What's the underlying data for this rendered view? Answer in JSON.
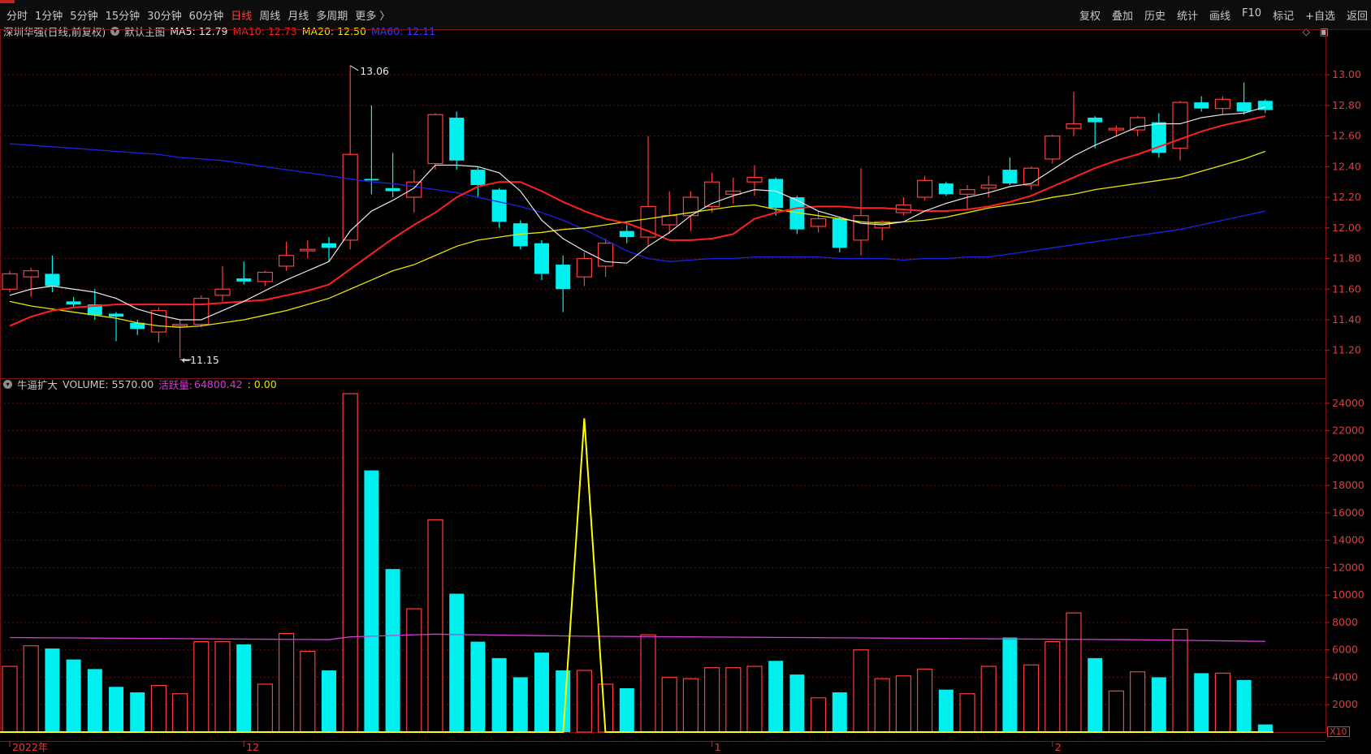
{
  "topbar": {
    "tabs": [
      {
        "label": "分时",
        "active": false
      },
      {
        "label": "1分钟",
        "active": false
      },
      {
        "label": "5分钟",
        "active": false
      },
      {
        "label": "15分钟",
        "active": false
      },
      {
        "label": "30分钟",
        "active": false
      },
      {
        "label": "60分钟",
        "active": false
      },
      {
        "label": "日线",
        "active": true
      },
      {
        "label": "周线",
        "active": false
      },
      {
        "label": "月线",
        "active": false
      },
      {
        "label": "多周期",
        "active": false
      },
      {
        "label": "更多 〉",
        "active": false
      }
    ],
    "tools": [
      "复权",
      "叠加",
      "历史",
      "统计",
      "画线",
      "F10",
      "标记",
      "+自选",
      "返回"
    ]
  },
  "info": {
    "stock": "深圳华强(日线,前复权)",
    "main_chart": "默认主图",
    "ma5": "MA5: 12.79",
    "ma10": "MA10: 12.73",
    "ma20": "MA20: 12.50",
    "ma60": "MA60: 12.11"
  },
  "vinfo": {
    "indicator": "牛逼扩大",
    "volume": "VOLUME: 5570.00",
    "active_label": "活跃量:",
    "active_value": "64800.42",
    "extra": ": 0.00"
  },
  "colors": {
    "up": "#ff3c3c",
    "down": "#00f0f0",
    "ma5": "#e8e8e8",
    "ma10": "#ff2020",
    "ma20": "#e6e600",
    "ma60": "#2020e6",
    "activity": "#d23cd2",
    "signal": "#ffff00"
  },
  "chart_data": {
    "type": "candlestick",
    "price_axis": {
      "ticks": [
        11.2,
        11.4,
        11.6,
        11.8,
        12.0,
        12.2,
        12.4,
        12.6,
        12.8,
        13.0
      ],
      "range": [
        11.05,
        13.25
      ]
    },
    "volume_axis": {
      "ticks": [
        2000,
        4000,
        6000,
        8000,
        10000,
        12000,
        14000,
        16000,
        18000,
        20000,
        22000,
        24000
      ],
      "range": [
        0,
        25000
      ],
      "unit": "X10"
    },
    "x_labels": [
      {
        "index": 0,
        "label": "2022年"
      },
      {
        "index": 11,
        "label": "12"
      },
      {
        "index": 33,
        "label": "1"
      },
      {
        "index": 49,
        "label": "2"
      }
    ],
    "high_mark": "13.06",
    "low_mark": "11.15",
    "candles": [
      [
        11.6,
        11.7,
        11.72,
        11.58,
        4800
      ],
      [
        11.68,
        11.72,
        11.74,
        11.55,
        6300
      ],
      [
        11.7,
        11.62,
        11.82,
        11.58,
        6100
      ],
      [
        11.52,
        11.5,
        11.55,
        11.48,
        5300
      ],
      [
        11.5,
        11.43,
        11.6,
        11.4,
        4600
      ],
      [
        11.44,
        11.42,
        11.45,
        11.26,
        3300
      ],
      [
        11.38,
        11.34,
        11.4,
        11.3,
        2900
      ],
      [
        11.32,
        11.46,
        11.48,
        11.25,
        3400
      ],
      [
        11.36,
        11.37,
        11.4,
        11.15,
        2800
      ],
      [
        11.37,
        11.54,
        11.56,
        11.35,
        6600
      ],
      [
        11.56,
        11.6,
        11.75,
        11.52,
        6600
      ],
      [
        11.67,
        11.65,
        11.78,
        11.63,
        6400
      ],
      [
        11.65,
        11.71,
        11.72,
        11.62,
        3500
      ],
      [
        11.75,
        11.82,
        11.91,
        11.72,
        7200
      ],
      [
        11.85,
        11.86,
        11.92,
        11.8,
        5900
      ],
      [
        11.9,
        11.87,
        11.94,
        11.78,
        4500
      ],
      [
        11.92,
        12.48,
        13.06,
        11.86,
        24700
      ],
      [
        12.32,
        12.31,
        12.8,
        12.22,
        19100
      ],
      [
        12.26,
        12.24,
        12.49,
        12.2,
        11900
      ],
      [
        12.2,
        12.3,
        12.38,
        12.1,
        9000
      ],
      [
        12.42,
        12.74,
        12.75,
        12.38,
        15500
      ],
      [
        12.72,
        12.44,
        12.76,
        12.38,
        10100
      ],
      [
        12.38,
        12.28,
        12.4,
        12.2,
        6600
      ],
      [
        12.25,
        12.04,
        12.26,
        12.0,
        5400
      ],
      [
        12.03,
        11.88,
        12.05,
        11.86,
        4000
      ],
      [
        11.9,
        11.7,
        11.92,
        11.66,
        5800
      ],
      [
        11.76,
        11.6,
        11.82,
        11.45,
        4500
      ],
      [
        11.68,
        11.8,
        11.84,
        11.62,
        4500
      ],
      [
        11.75,
        11.9,
        11.93,
        11.68,
        3500
      ],
      [
        11.98,
        11.94,
        12.02,
        11.9,
        3200
      ],
      [
        11.94,
        12.14,
        12.6,
        11.88,
        7100
      ],
      [
        12.02,
        12.08,
        12.24,
        11.96,
        4000
      ],
      [
        12.08,
        12.2,
        12.24,
        11.98,
        3900
      ],
      [
        12.14,
        12.3,
        12.36,
        12.1,
        4700
      ],
      [
        12.22,
        12.24,
        12.33,
        12.16,
        4700
      ],
      [
        12.3,
        12.33,
        12.41,
        12.21,
        4800
      ],
      [
        12.32,
        12.13,
        12.33,
        12.08,
        5200
      ],
      [
        12.2,
        11.99,
        12.21,
        11.96,
        4200
      ],
      [
        12.01,
        12.06,
        12.11,
        11.97,
        2500
      ],
      [
        12.06,
        11.87,
        12.07,
        11.84,
        2900
      ],
      [
        11.92,
        12.08,
        12.39,
        11.82,
        6000
      ],
      [
        12.0,
        12.04,
        12.05,
        11.92,
        3900
      ],
      [
        12.1,
        12.15,
        12.2,
        12.08,
        4100
      ],
      [
        12.2,
        12.31,
        12.34,
        12.18,
        4600
      ],
      [
        12.29,
        12.22,
        12.3,
        12.21,
        3100
      ],
      [
        12.22,
        12.25,
        12.28,
        12.12,
        2800
      ],
      [
        12.26,
        12.28,
        12.34,
        12.2,
        4800
      ],
      [
        12.38,
        12.29,
        12.46,
        12.28,
        6900
      ],
      [
        12.28,
        12.39,
        12.4,
        12.25,
        4900
      ],
      [
        12.45,
        12.6,
        12.61,
        12.42,
        6600
      ],
      [
        12.65,
        12.68,
        12.89,
        12.6,
        8700
      ],
      [
        12.72,
        12.69,
        12.73,
        12.52,
        5400
      ],
      [
        12.64,
        12.65,
        12.67,
        12.6,
        3000
      ],
      [
        12.64,
        12.72,
        12.73,
        12.6,
        4400
      ],
      [
        12.69,
        12.49,
        12.75,
        12.46,
        4000
      ],
      [
        12.52,
        12.82,
        12.83,
        12.44,
        7500
      ],
      [
        12.82,
        12.78,
        12.86,
        12.76,
        4300
      ],
      [
        12.78,
        12.84,
        12.86,
        12.74,
        4300
      ],
      [
        12.82,
        12.76,
        12.95,
        12.74,
        3800
      ],
      [
        12.83,
        12.77,
        12.84,
        12.75,
        557
      ]
    ],
    "ma5": [
      11.56,
      11.6,
      11.62,
      11.6,
      11.58,
      11.54,
      11.47,
      11.43,
      11.4,
      11.4,
      11.46,
      11.52,
      11.59,
      11.66,
      11.72,
      11.78,
      11.98,
      12.11,
      12.18,
      12.26,
      12.41,
      12.41,
      12.4,
      12.36,
      12.24,
      12.05,
      11.93,
      11.85,
      11.78,
      11.77,
      11.88,
      11.97,
      12.08,
      12.16,
      12.21,
      12.25,
      12.24,
      12.18,
      12.11,
      12.07,
      12.03,
      12.02,
      12.04,
      12.11,
      12.16,
      12.2,
      12.23,
      12.27,
      12.29,
      12.38,
      12.47,
      12.54,
      12.6,
      12.66,
      12.68,
      12.68,
      12.72,
      12.74,
      12.75,
      12.79
    ],
    "ma10": [
      11.36,
      11.42,
      11.46,
      11.48,
      11.49,
      11.5,
      11.5,
      11.5,
      11.5,
      11.5,
      11.51,
      11.52,
      11.53,
      11.56,
      11.59,
      11.63,
      11.73,
      11.83,
      11.93,
      12.02,
      12.1,
      12.2,
      12.27,
      12.3,
      12.3,
      12.24,
      12.17,
      12.11,
      12.06,
      12.03,
      11.98,
      11.92,
      11.92,
      11.93,
      11.96,
      12.06,
      12.1,
      12.13,
      12.14,
      12.14,
      12.13,
      12.13,
      12.12,
      12.11,
      12.11,
      12.12,
      12.14,
      12.17,
      12.21,
      12.27,
      12.33,
      12.39,
      12.44,
      12.48,
      12.53,
      12.58,
      12.63,
      12.67,
      12.7,
      12.73
    ],
    "ma20": [
      11.52,
      11.49,
      11.47,
      11.45,
      11.43,
      11.41,
      11.38,
      11.36,
      11.35,
      11.36,
      11.38,
      11.4,
      11.43,
      11.46,
      11.5,
      11.54,
      11.6,
      11.66,
      11.72,
      11.76,
      11.82,
      11.88,
      11.92,
      11.94,
      11.96,
      11.97,
      11.99,
      12.0,
      12.02,
      12.04,
      12.06,
      12.08,
      12.1,
      12.12,
      12.14,
      12.15,
      12.12,
      12.1,
      12.08,
      12.06,
      12.04,
      12.03,
      12.04,
      12.05,
      12.07,
      12.1,
      12.13,
      12.15,
      12.17,
      12.2,
      12.22,
      12.25,
      12.27,
      12.29,
      12.31,
      12.33,
      12.37,
      12.41,
      12.45,
      12.5
    ],
    "ma60": [
      12.55,
      12.54,
      12.53,
      12.52,
      12.51,
      12.5,
      12.49,
      12.48,
      12.46,
      12.45,
      12.44,
      12.42,
      12.4,
      12.38,
      12.36,
      12.34,
      12.32,
      12.3,
      12.29,
      12.27,
      12.25,
      12.23,
      12.2,
      12.17,
      12.14,
      12.1,
      12.05,
      11.99,
      11.92,
      11.85,
      11.8,
      11.78,
      11.79,
      11.8,
      11.8,
      11.81,
      11.81,
      11.81,
      11.81,
      11.8,
      11.8,
      11.8,
      11.79,
      11.8,
      11.8,
      11.81,
      11.81,
      11.83,
      11.85,
      11.87,
      11.89,
      11.91,
      11.93,
      11.95,
      11.97,
      11.99,
      12.02,
      12.05,
      12.08,
      12.11
    ],
    "activity": [
      6900,
      6890,
      6880,
      6870,
      6860,
      6850,
      6840,
      6830,
      6820,
      6810,
      6800,
      6790,
      6780,
      6770,
      6760,
      6750,
      6950,
      7000,
      7050,
      7100,
      7150,
      7120,
      7100,
      7080,
      7060,
      7040,
      7020,
      7000,
      6990,
      6980,
      6970,
      6960,
      6950,
      6940,
      6930,
      6920,
      6910,
      6900,
      6890,
      6880,
      6870,
      6860,
      6850,
      6840,
      6830,
      6820,
      6810,
      6800,
      6790,
      6780,
      6770,
      6760,
      6750,
      6740,
      6720,
      6700,
      6680,
      6660,
      6640,
      6620
    ],
    "signal_peak": {
      "index": 27,
      "value": 22900
    }
  }
}
